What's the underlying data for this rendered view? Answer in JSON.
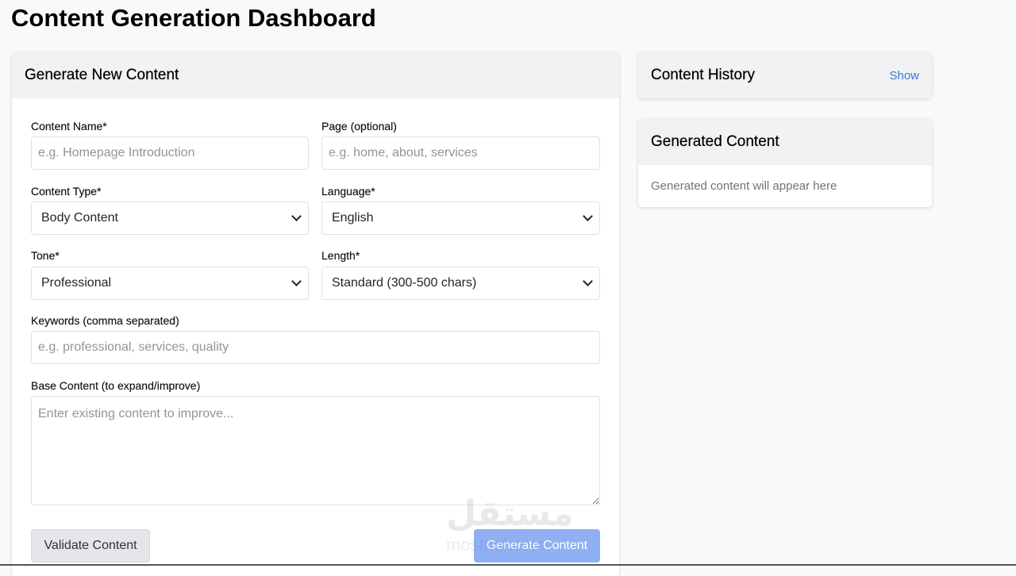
{
  "page": {
    "title": "Content Generation Dashboard"
  },
  "form": {
    "header": "Generate New Content",
    "content_name": {
      "label": "Content Name*",
      "placeholder": "e.g. Homepage Introduction",
      "value": ""
    },
    "page_field": {
      "label": "Page (optional)",
      "placeholder": "e.g. home, about, services",
      "value": ""
    },
    "content_type": {
      "label": "Content Type*",
      "selected": "Body Content"
    },
    "language": {
      "label": "Language*",
      "selected": "English"
    },
    "tone": {
      "label": "Tone*",
      "selected": "Professional"
    },
    "length": {
      "label": "Length*",
      "selected": "Standard (300-500 chars)"
    },
    "keywords": {
      "label": "Keywords (comma separated)",
      "placeholder": "e.g. professional, services, quality",
      "value": ""
    },
    "base_content": {
      "label": "Base Content (to expand/improve)",
      "placeholder": "Enter existing content to improve...",
      "value": ""
    },
    "validate_button": "Validate Content",
    "generate_button": "Generate Content"
  },
  "history": {
    "title": "Content History",
    "toggle_label": "Show"
  },
  "generated": {
    "title": "Generated Content",
    "empty_text": "Generated content will appear here"
  },
  "watermark": {
    "text": "مستقل",
    "sub": "mostaql.com"
  },
  "colors": {
    "primary_button": "#8fb0f5",
    "link": "#3b78d8",
    "card_header": "#f1f2f4",
    "page_background": "#f8f9fa"
  },
  "icons": {
    "select_arrow": "chevron-down-icon"
  }
}
